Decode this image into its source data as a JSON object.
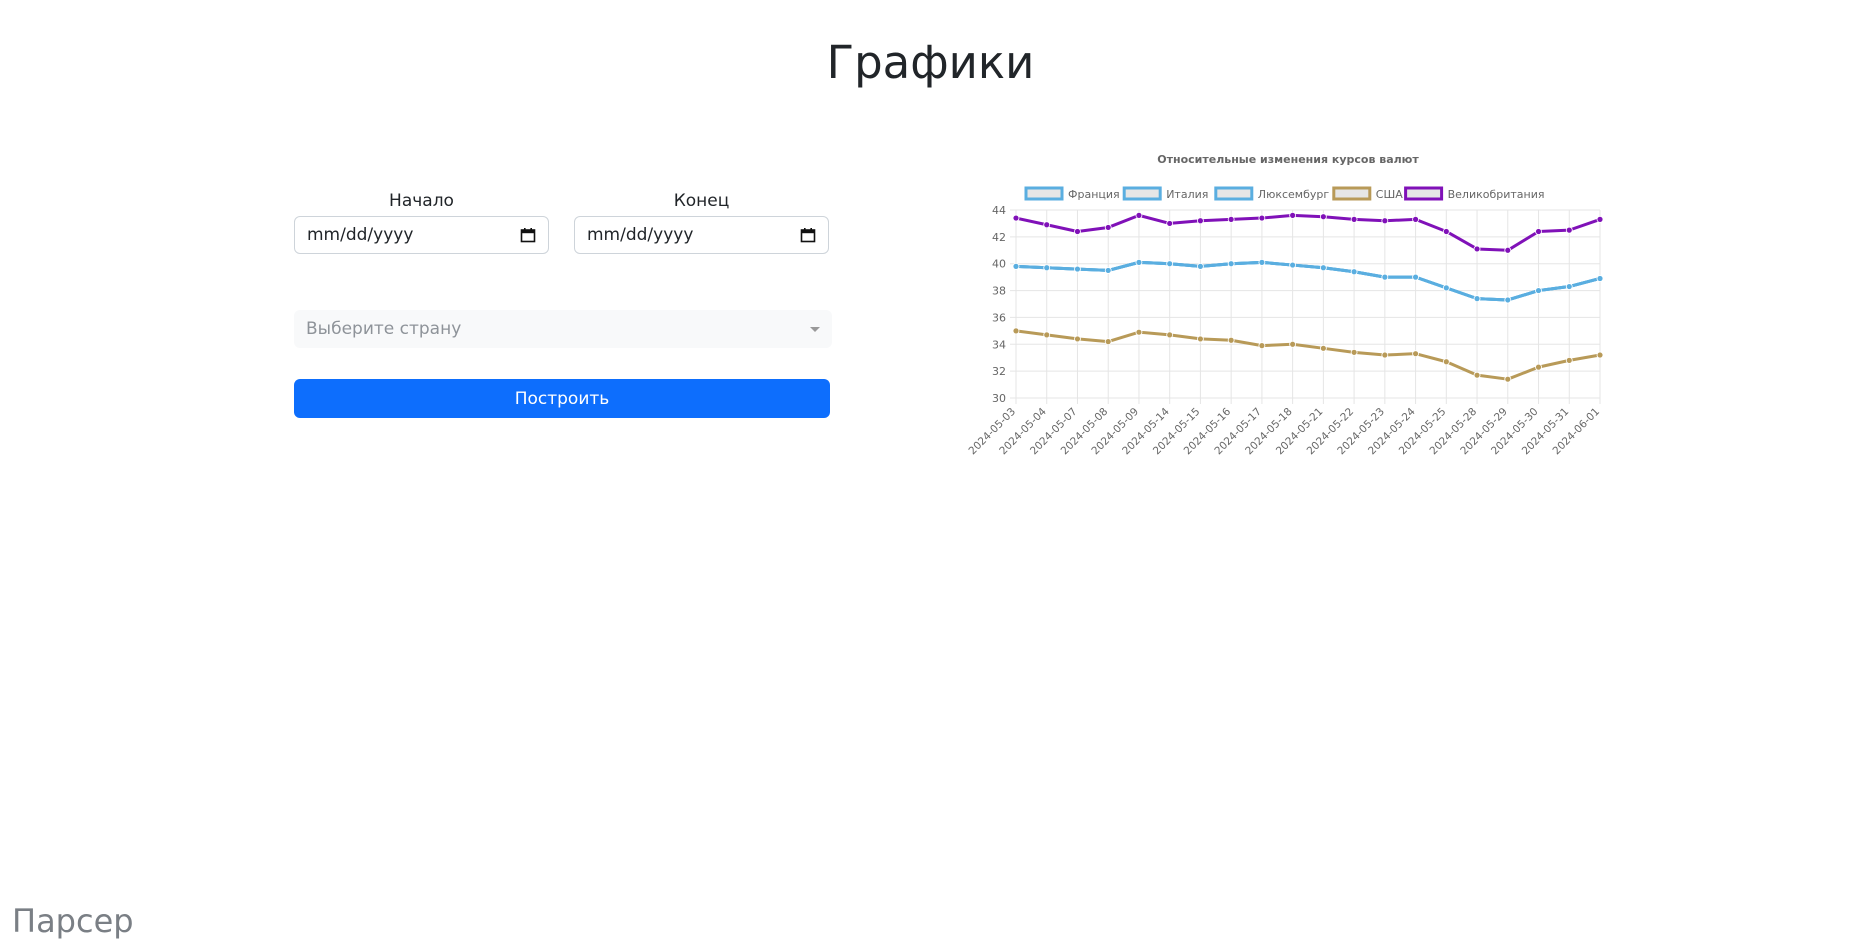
{
  "page": {
    "title": "Графики"
  },
  "form": {
    "start_label": "Начало",
    "start_value": "mm/dd/yyyy",
    "end_label": "Конец",
    "end_value": "mm/dd/yyyy",
    "country_placeholder": "Выберите страну",
    "build_label": "Построить"
  },
  "footer": {
    "brand": "Парсер"
  },
  "chart_data": {
    "type": "line",
    "title": "Относительные изменения курсов валют",
    "legend_position": "top",
    "grid": true,
    "ylim": [
      30,
      44
    ],
    "yticks": [
      30,
      32,
      34,
      36,
      38,
      40,
      42,
      44
    ],
    "categories": [
      "2024-05-03",
      "2024-05-04",
      "2024-05-07",
      "2024-05-08",
      "2024-05-09",
      "2024-05-14",
      "2024-05-15",
      "2024-05-16",
      "2024-05-17",
      "2024-05-18",
      "2024-05-21",
      "2024-05-22",
      "2024-05-23",
      "2024-05-24",
      "2024-05-25",
      "2024-05-28",
      "2024-05-29",
      "2024-05-30",
      "2024-05-31",
      "2024-06-01"
    ],
    "series": [
      {
        "name": "Франция",
        "color": "#5aaee0",
        "values": [
          39.8,
          39.7,
          39.6,
          39.5,
          40.1,
          40.0,
          39.8,
          40.0,
          40.1,
          39.9,
          39.7,
          39.4,
          39.0,
          39.0,
          38.2,
          37.4,
          37.3,
          38.0,
          38.3,
          38.9
        ]
      },
      {
        "name": "Италия",
        "color": "#5aaee0",
        "values": [
          39.8,
          39.7,
          39.6,
          39.5,
          40.1,
          40.0,
          39.8,
          40.0,
          40.1,
          39.9,
          39.7,
          39.4,
          39.0,
          39.0,
          38.2,
          37.4,
          37.3,
          38.0,
          38.3,
          38.9
        ]
      },
      {
        "name": "Люксембург",
        "color": "#5aaee0",
        "values": [
          39.8,
          39.7,
          39.6,
          39.5,
          40.1,
          40.0,
          39.8,
          40.0,
          40.1,
          39.9,
          39.7,
          39.4,
          39.0,
          39.0,
          38.2,
          37.4,
          37.3,
          38.0,
          38.3,
          38.9
        ]
      },
      {
        "name": "США",
        "color": "#b89a58",
        "values": [
          35.0,
          34.7,
          34.4,
          34.2,
          34.9,
          34.7,
          34.4,
          34.3,
          33.9,
          34.0,
          33.7,
          33.4,
          33.2,
          33.3,
          32.7,
          31.7,
          31.4,
          32.3,
          32.8,
          33.2
        ]
      },
      {
        "name": "Великобритания",
        "color": "#8011b8",
        "values": [
          43.4,
          42.9,
          42.4,
          42.7,
          43.6,
          43.0,
          43.2,
          43.3,
          43.4,
          43.6,
          43.5,
          43.3,
          43.2,
          43.3,
          42.4,
          41.1,
          41.0,
          42.4,
          42.5,
          43.3
        ]
      }
    ]
  }
}
